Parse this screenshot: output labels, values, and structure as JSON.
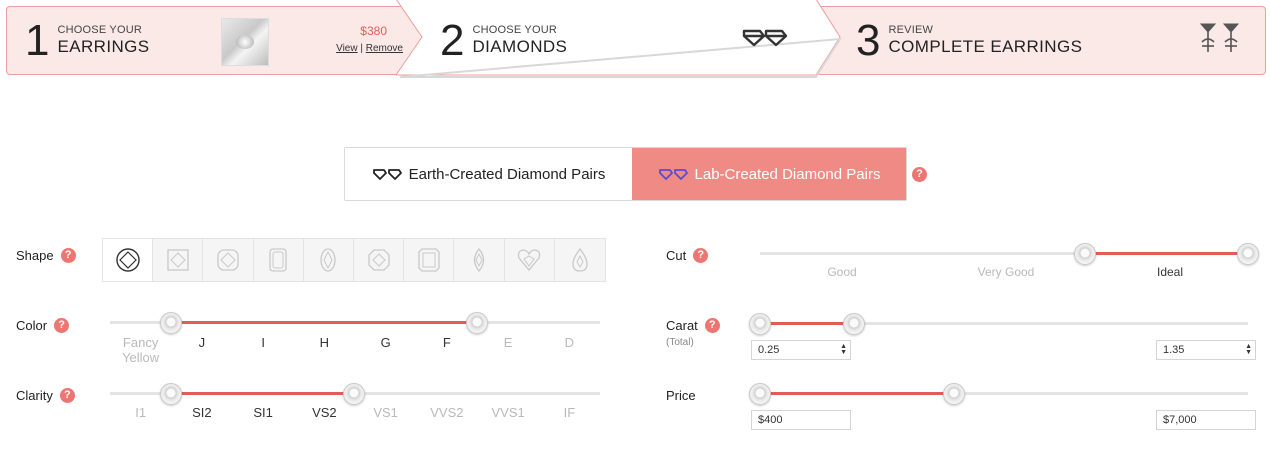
{
  "steps": [
    {
      "num": "1",
      "small": "CHOOSE YOUR",
      "big": "EARRINGS",
      "price": "$380",
      "view": "View",
      "sep": " | ",
      "remove": "Remove"
    },
    {
      "num": "2",
      "small": "CHOOSE YOUR",
      "big": "DIAMONDS"
    },
    {
      "num": "3",
      "small": "REVIEW",
      "big": "COMPLETE EARRINGS"
    }
  ],
  "toggle": {
    "earth": "Earth-Created Diamond Pairs",
    "lab": "Lab-Created Diamond Pairs",
    "selected": "lab",
    "help": "?"
  },
  "filters": {
    "shape": {
      "label": "Shape",
      "help": "?",
      "options": [
        "round-icon",
        "princess-icon",
        "cushion-icon",
        "emerald-icon",
        "oval-icon",
        "asscher-icon",
        "radiant-icon",
        "marquise-icon",
        "heart-icon",
        "pear-icon"
      ],
      "selected": "round-icon"
    },
    "color": {
      "label": "Color",
      "help": "?",
      "ticks": [
        "Fancy\nYellow",
        "J",
        "I",
        "H",
        "G",
        "F",
        "E",
        "D"
      ],
      "active": [
        false,
        true,
        true,
        true,
        true,
        true,
        false,
        false
      ]
    },
    "clarity": {
      "label": "Clarity",
      "help": "?",
      "ticks": [
        "I1",
        "SI2",
        "SI1",
        "VS2",
        "VS1",
        "VVS2",
        "VVS1",
        "IF"
      ],
      "active": [
        false,
        true,
        true,
        true,
        false,
        false,
        false,
        false
      ]
    },
    "cut": {
      "label": "Cut",
      "help": "?",
      "ticks": [
        "Good",
        "Very Good",
        "Ideal"
      ],
      "active": [
        false,
        false,
        true
      ]
    },
    "carat": {
      "label": "Carat",
      "note": "(Total)",
      "help": "?",
      "min": "0.25",
      "max": "1.35"
    },
    "price": {
      "label": "Price",
      "min": "$400",
      "max": "$7,000"
    }
  },
  "colors": {
    "accent": "#e45c57",
    "accent_light": "#ef8a85",
    "step_bg": "#fbe9e8",
    "help": "#ee7571"
  }
}
